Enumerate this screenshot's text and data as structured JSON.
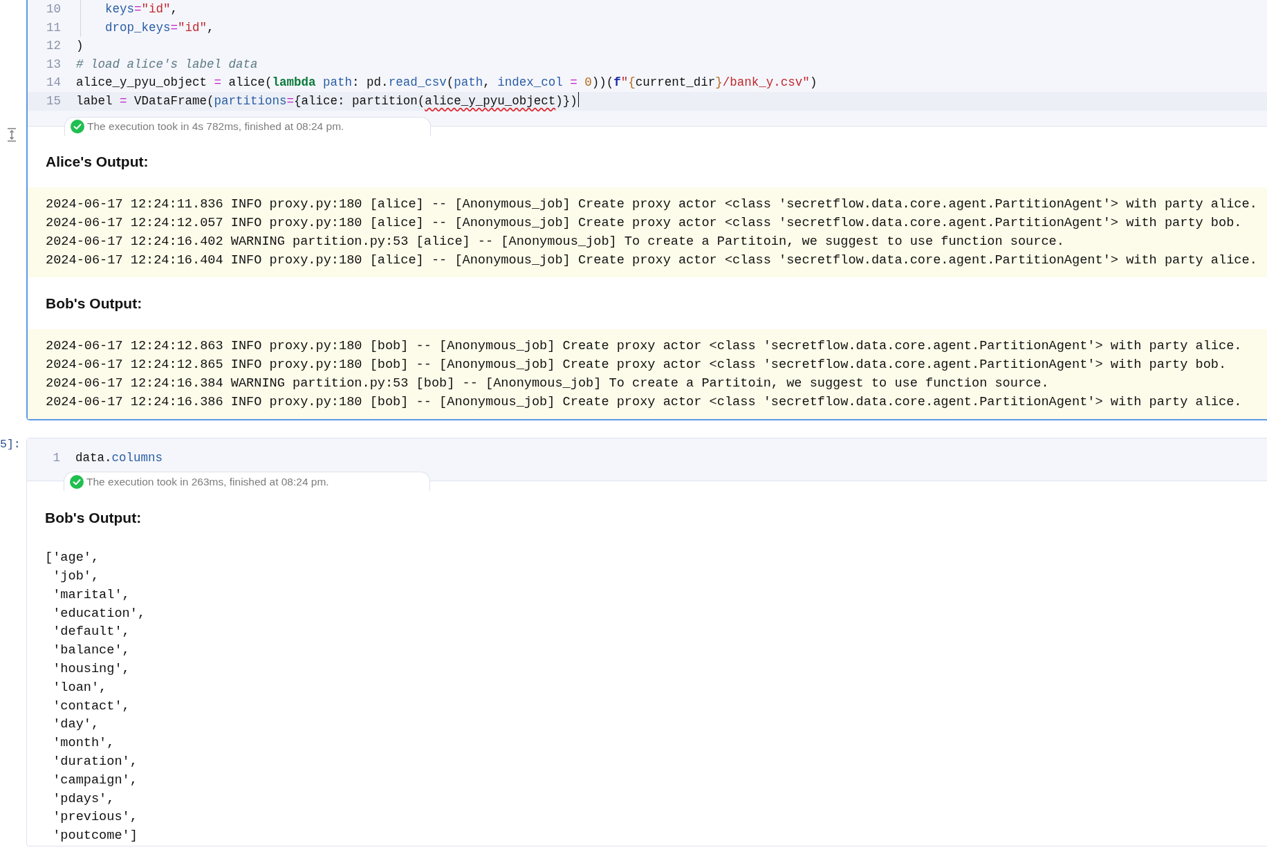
{
  "cells": [
    {
      "selected": true,
      "code": [
        {
          "number": "10",
          "active": false,
          "indented": true,
          "tokens": [
            {
              "kind": "param",
              "text": "keys"
            },
            {
              "kind": "op",
              "text": "="
            },
            {
              "kind": "string",
              "text": "\"id\""
            },
            {
              "kind": "plain",
              "text": ","
            }
          ]
        },
        {
          "number": "11",
          "active": false,
          "indented": true,
          "tokens": [
            {
              "kind": "param",
              "text": "drop_keys"
            },
            {
              "kind": "op",
              "text": "="
            },
            {
              "kind": "string",
              "text": "\"id\""
            },
            {
              "kind": "plain",
              "text": ","
            }
          ]
        },
        {
          "number": "12",
          "active": false,
          "tokens": [
            {
              "kind": "plain",
              "text": ")"
            }
          ]
        },
        {
          "number": "13",
          "active": false,
          "tokens": [
            {
              "kind": "comment",
              "text": "# load alice's label data"
            }
          ]
        },
        {
          "number": "14",
          "active": false,
          "tokens": [
            {
              "kind": "plain",
              "text": "alice_y_pyu_object "
            },
            {
              "kind": "op",
              "text": "="
            },
            {
              "kind": "plain",
              "text": " alice("
            },
            {
              "kind": "keyword",
              "text": "lambda"
            },
            {
              "kind": "param",
              "text": " path"
            },
            {
              "kind": "plain",
              "text": ": pd."
            },
            {
              "kind": "param",
              "text": "read_csv"
            },
            {
              "kind": "plain",
              "text": "("
            },
            {
              "kind": "param",
              "text": "path"
            },
            {
              "kind": "plain",
              "text": ", "
            },
            {
              "kind": "param",
              "text": "index_col"
            },
            {
              "kind": "op",
              "text": " = "
            },
            {
              "kind": "number",
              "text": "0"
            },
            {
              "kind": "plain",
              "text": "))("
            },
            {
              "kind": "fprefix",
              "text": "f"
            },
            {
              "kind": "string",
              "text": "\""
            },
            {
              "kind": "brace",
              "text": "{"
            },
            {
              "kind": "plain",
              "text": "current_dir"
            },
            {
              "kind": "brace",
              "text": "}"
            },
            {
              "kind": "string",
              "text": "/bank_y.csv\""
            },
            {
              "kind": "plain",
              "text": ")"
            }
          ]
        },
        {
          "number": "15",
          "active": true,
          "tokens": [
            {
              "kind": "plain",
              "text": "label "
            },
            {
              "kind": "op",
              "text": "="
            },
            {
              "kind": "plain",
              "text": " VDataFrame("
            },
            {
              "kind": "param",
              "text": "partitions"
            },
            {
              "kind": "op",
              "text": "="
            },
            {
              "kind": "plain",
              "text": "{alice: partition("
            },
            {
              "kind": "error",
              "text": "alice_y_pyu_object"
            },
            {
              "kind": "plain",
              "text": ")})"
            }
          ]
        }
      ],
      "execution": {
        "text": "The execution took in 4s 782ms, finished at 08:24 pm."
      },
      "outputs": [
        {
          "kind": "log",
          "heading": "Alice's Output:",
          "lines": [
            "2024-06-17 12:24:11.836 INFO proxy.py:180 [alice] -- [Anonymous_job] Create proxy actor <class 'secretflow.data.core.agent.PartitionAgent'> with party alice.",
            "2024-06-17 12:24:12.057 INFO proxy.py:180 [alice] -- [Anonymous_job] Create proxy actor <class 'secretflow.data.core.agent.PartitionAgent'> with party bob.",
            "2024-06-17 12:24:16.402 WARNING partition.py:53 [alice] -- [Anonymous_job] To create a Partitoin, we suggest to use function source.",
            "2024-06-17 12:24:16.404 INFO proxy.py:180 [alice] -- [Anonymous_job] Create proxy actor <class 'secretflow.data.core.agent.PartitionAgent'> with party alice."
          ]
        },
        {
          "kind": "log",
          "heading": "Bob's Output:",
          "lines": [
            "2024-06-17 12:24:12.863 INFO proxy.py:180 [bob] -- [Anonymous_job] Create proxy actor <class 'secretflow.data.core.agent.PartitionAgent'> with party alice.",
            "2024-06-17 12:24:12.865 INFO proxy.py:180 [bob] -- [Anonymous_job] Create proxy actor <class 'secretflow.data.core.agent.PartitionAgent'> with party bob.",
            "2024-06-17 12:24:16.384 WARNING partition.py:53 [bob] -- [Anonymous_job] To create a Partitoin, we suggest to use function source.",
            "2024-06-17 12:24:16.386 INFO proxy.py:180 [bob] -- [Anonymous_job] Create proxy actor <class 'secretflow.data.core.agent.PartitionAgent'> with party alice."
          ]
        }
      ]
    },
    {
      "prompt": "5]:",
      "selected": false,
      "code": [
        {
          "number": "1",
          "active": false,
          "tokens": [
            {
              "kind": "plain",
              "text": "data."
            },
            {
              "kind": "param",
              "text": "columns"
            }
          ]
        }
      ],
      "execution": {
        "text": "The execution took in 263ms, finished at 08:24 pm."
      },
      "outputs": [
        {
          "kind": "plain",
          "heading": "Bob's Output:",
          "lines": [
            "['age',",
            " 'job',",
            " 'marital',",
            " 'education',",
            " 'default',",
            " 'balance',",
            " 'housing',",
            " 'loan',",
            " 'contact',",
            " 'day',",
            " 'month',",
            " 'duration',",
            " 'campaign',",
            " 'pdays',",
            " 'previous',",
            " 'poutcome']"
          ]
        }
      ]
    }
  ]
}
